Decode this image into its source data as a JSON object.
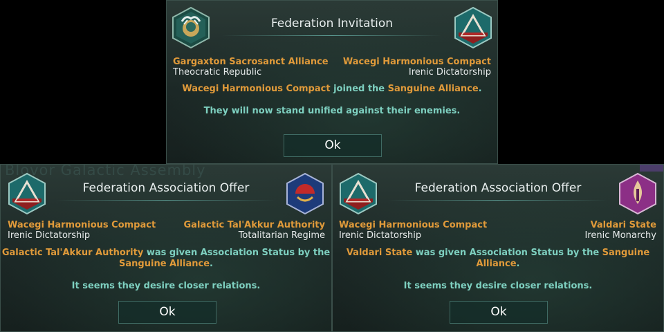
{
  "top_dialog": {
    "title": "Federation Invitation",
    "left_party": {
      "name": "Gargaxton Sacrosanct Alliance",
      "government": "Theocratic Republic"
    },
    "right_party": {
      "name": "Wacegi Harmonious Compact",
      "government": "Irenic Dictatorship"
    },
    "message": {
      "actor": "Wacegi Harmonious Compact",
      "verb": "joined the",
      "target": "Sanguine Alliance",
      "end": "."
    },
    "flavor": "They will now stand unified against their enemies.",
    "ok_label": "Ok"
  },
  "left_dialog": {
    "background_text": "Blovor Galactic Assembly",
    "title": "Federation Association Offer",
    "left_party": {
      "name": "Wacegi Harmonious Compact",
      "government": "Irenic Dictatorship"
    },
    "right_party": {
      "name": "Galactic Tal'Akkur Authority",
      "government": "Totalitarian Regime"
    },
    "message": {
      "actor": "Galactic Tal'Akkur Authority",
      "verb": "was given Association Status by the",
      "target": "Sanguine Alliance",
      "end": "."
    },
    "flavor": "It seems they desire closer relations.",
    "ok_label": "Ok"
  },
  "right_dialog": {
    "title": "Federation Association Offer",
    "left_party": {
      "name": "Wacegi Harmonious Compact",
      "government": "Irenic Dictatorship"
    },
    "right_party": {
      "name": "Valdari State",
      "government": "Irenic Monarchy"
    },
    "message": {
      "actor": "Valdari State",
      "verb": "was given Association Status by the",
      "target": "Sanguine",
      "target2": "Alliance",
      "end": "."
    },
    "flavor": "It seems they desire closer relations.",
    "ok_label": "Ok"
  },
  "colors": {
    "empire_name": "#e09a3a",
    "message_text": "#7ed0c0",
    "wacegi_emblem_top": "#1d6a6a",
    "wacegi_emblem_bottom": "#8f1f1f",
    "valdari_emblem": "#8c2f86",
    "talakkur_emblem": "#1d3b7a"
  },
  "icons": {
    "gargaxton": "gargaxton-flag-icon",
    "wacegi": "wacegi-flag-icon",
    "talakkur": "talakkur-flag-icon",
    "valdari": "valdari-flag-icon"
  }
}
